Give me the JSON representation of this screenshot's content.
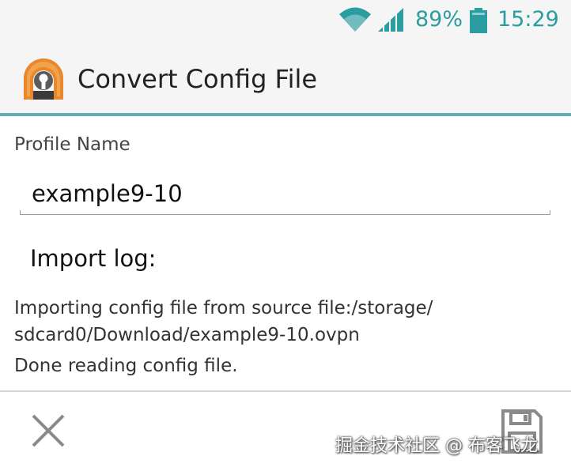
{
  "status_bar": {
    "battery_percent": "89%",
    "time": "15:29",
    "icons": [
      "wifi-icon",
      "signal-icon",
      "battery-icon"
    ],
    "accent_color": "#2a9da0"
  },
  "action_bar": {
    "title": "Convert Config File",
    "app_icon": "openvpn-icon",
    "divider_color": "#5fb0b4"
  },
  "form": {
    "profile_label": "Profile Name",
    "profile_value": "example9-10"
  },
  "import_log": {
    "heading": "Import log:",
    "lines": [
      "Importing config file from source file:/storage/",
      "sdcard0/Download/example9-10.ovpn",
      "Done reading config file."
    ]
  },
  "bottom_bar": {
    "cancel_icon": "close-icon",
    "save_icon": "save-icon"
  },
  "watermark": "掘金技术社区 @ 布客飞龙"
}
